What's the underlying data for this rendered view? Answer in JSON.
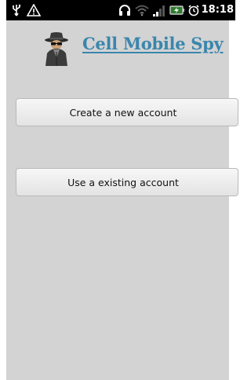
{
  "status_bar": {
    "time": "18:18",
    "icons": [
      "usb-icon",
      "warning-icon",
      "headset-icon",
      "wifi-icon",
      "signal-icon",
      "battery-charging-icon",
      "alarm-icon"
    ]
  },
  "header": {
    "app_title": "Cell Mobile Spy",
    "logo_icon": "spy-avatar-icon"
  },
  "actions": {
    "create_account_label": "Create a new account",
    "existing_account_label": "Use a existing account"
  },
  "colors": {
    "background": "#d3d3d3",
    "title": "#3a86ad",
    "status_bar": "#000000"
  }
}
